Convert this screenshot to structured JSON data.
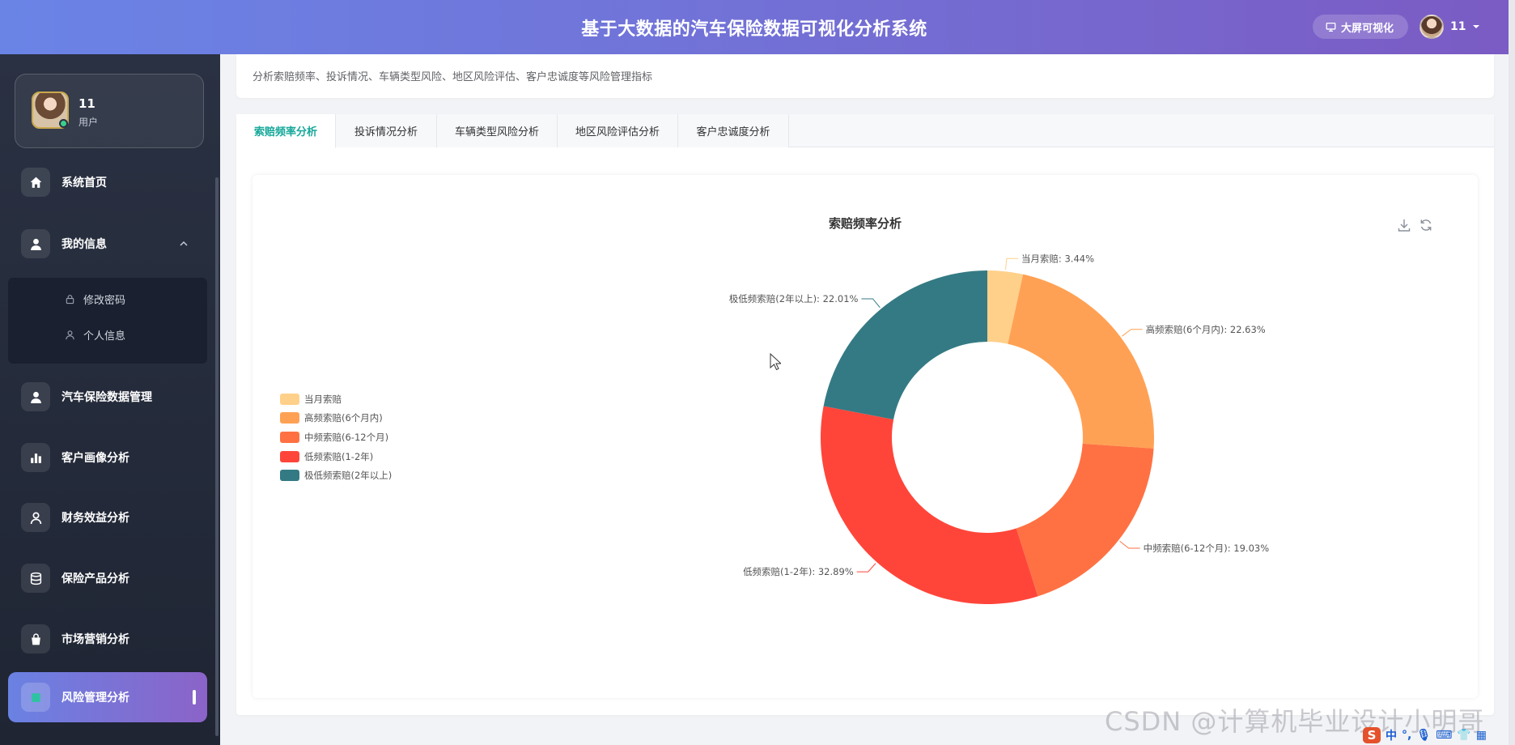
{
  "header": {
    "title": "基于大数据的汽车保险数据可视化分析系统",
    "bigscreen_label": "大屏可视化",
    "username": "11"
  },
  "sidebar": {
    "user": {
      "name": "11",
      "role": "用户"
    },
    "items": [
      {
        "label": "系统首页",
        "icon": "home-icon"
      },
      {
        "label": "我的信息",
        "icon": "user-icon",
        "expanded": true,
        "children": [
          {
            "label": "修改密码",
            "icon": "lock-icon"
          },
          {
            "label": "个人信息",
            "icon": "person-outline-icon"
          }
        ]
      },
      {
        "label": "汽车保险数据管理",
        "icon": "user-icon"
      },
      {
        "label": "客户画像分析",
        "icon": "bar-chart-icon"
      },
      {
        "label": "财务效益分析",
        "icon": "person-outline-icon"
      },
      {
        "label": "保险产品分析",
        "icon": "database-icon"
      },
      {
        "label": "市场营销分析",
        "icon": "shopping-bag-icon"
      },
      {
        "label": "风险管理分析",
        "icon": "square-icon",
        "active": true
      }
    ]
  },
  "main": {
    "description": "分析索赔频率、投诉情况、车辆类型风险、地区风险评估、客户忠诚度等风险管理指标",
    "tabs": [
      {
        "label": "索赔频率分析",
        "active": true
      },
      {
        "label": "投诉情况分析"
      },
      {
        "label": "车辆类型风险分析"
      },
      {
        "label": "地区风险评估分析"
      },
      {
        "label": "客户忠诚度分析"
      }
    ]
  },
  "chart_data": {
    "type": "pie",
    "variant": "donut",
    "title": "索赔频率分析",
    "legend_position": "left",
    "slices": [
      {
        "name": "当月索赔",
        "value": 3.44,
        "label": "当月索赔: 3.44%",
        "color": "#ffd08a"
      },
      {
        "name": "高频索赔(6个月内)",
        "value": 22.63,
        "label": "高频索赔(6个月内): 22.63%",
        "color": "#ffa154"
      },
      {
        "name": "中频索赔(6-12个月)",
        "value": 19.03,
        "label": "中频索赔(6-12个月): 19.03%",
        "color": "#ff7143"
      },
      {
        "name": "低频索赔(1-2年)",
        "value": 32.89,
        "label": "低频索赔(1-2年): 32.89%",
        "color": "#ff453a"
      },
      {
        "name": "极低频索赔(2年以上)",
        "value": 22.01,
        "label": "极低频索赔(2年以上): 22.01%",
        "color": "#347a84"
      }
    ]
  },
  "watermark": "CSDN @计算机毕业设计小明哥",
  "tray": {
    "ime": "中"
  }
}
